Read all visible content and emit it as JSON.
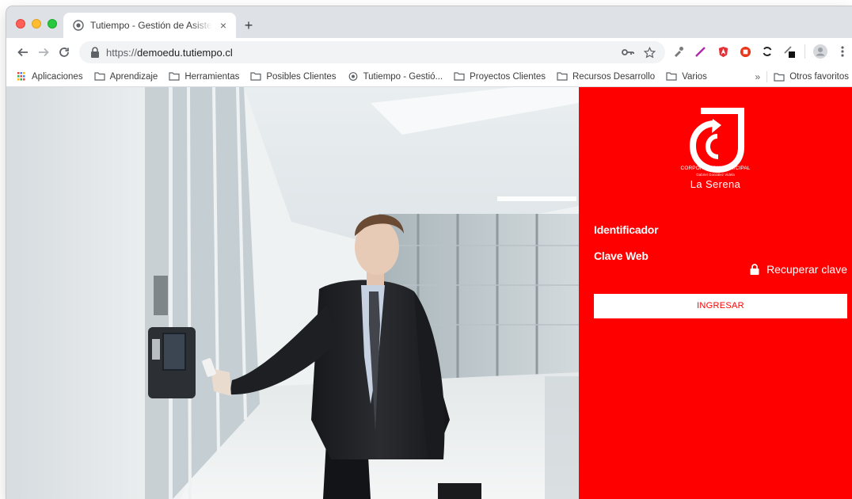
{
  "browser": {
    "tab_title": "Tutiempo - Gestión de Asistencia",
    "new_tab_symbol": "+",
    "close_symbol": "×",
    "url_scheme": "https://",
    "url_host": "demoedu.tutiempo.cl"
  },
  "bookmarks": [
    {
      "label": "Aplicaciones",
      "icon": "apps-grid-icon"
    },
    {
      "label": "Aprendizaje",
      "icon": "folder-icon"
    },
    {
      "label": "Herramientas",
      "icon": "folder-icon"
    },
    {
      "label": "Posibles Clientes",
      "icon": "folder-icon"
    },
    {
      "label": "Tutiempo - Gestió...",
      "icon": "site-favicon-icon"
    },
    {
      "label": "Proyectos Clientes",
      "icon": "folder-icon"
    },
    {
      "label": "Recursos Desarrollo",
      "icon": "folder-icon"
    },
    {
      "label": "Varios",
      "icon": "folder-icon"
    }
  ],
  "bookmarks_overflow": "»",
  "other_bookmarks": "Otros favoritos",
  "brand": {
    "line1": "CORPORACION MUNICIPAL",
    "line2": "Gabriel González Videla",
    "line3": "La Serena"
  },
  "form": {
    "identifier_label": "Identificador",
    "password_label": "Clave Web",
    "recover_label": "Recuperar clave",
    "submit_label": "INGRESAR"
  },
  "colors": {
    "panel": "#ff0000",
    "button_bg": "#ffffff",
    "button_text": "#ff0000"
  }
}
